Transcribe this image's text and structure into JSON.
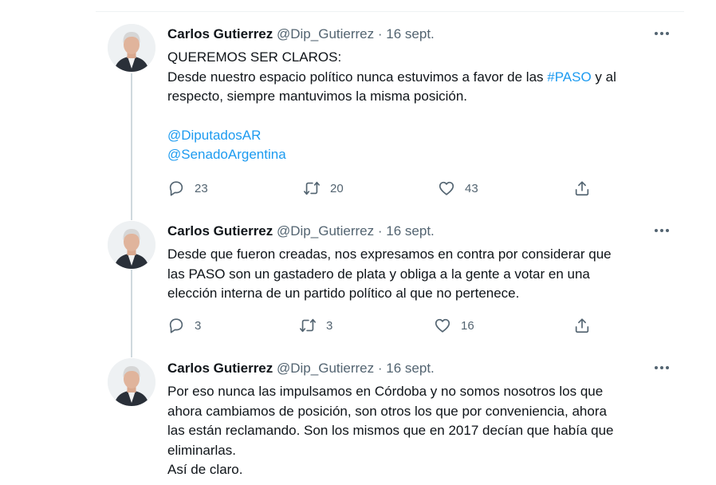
{
  "tweets": [
    {
      "name": "Carlos Gutierrez",
      "handle": "@Dip_Gutierrez",
      "separator": "·",
      "date": "16 sept.",
      "line1": "QUEREMOS SER CLAROS:",
      "line2_pre": "Desde nuestro espacio político nunca estuvimos a favor de las ",
      "hashtag": "#PASO",
      "line2_post": " y al",
      "line3": "respecto, siempre mantuvimos la misma posición.",
      "mention1": "@DiputadosAR",
      "mention2": "@SenadoArgentina",
      "replies": "23",
      "retweets": "20",
      "likes": "43"
    },
    {
      "name": "Carlos Gutierrez",
      "handle": "@Dip_Gutierrez",
      "separator": "·",
      "date": "16 sept.",
      "line1": "Desde que fueron creadas, nos expresamos en contra por considerar que",
      "line2": "las PASO son un gastadero de plata y obliga a la gente a votar en una",
      "line3": "elección interna de un partido político al que no pertenece.",
      "replies": "3",
      "retweets": "3",
      "likes": "16"
    },
    {
      "name": "Carlos Gutierrez",
      "handle": "@Dip_Gutierrez",
      "separator": "·",
      "date": "16 sept.",
      "line1": "Por eso nunca las impulsamos en Córdoba y no somos nosotros los que",
      "line2": "ahora cambiamos de posición, son otros los que por conveniencia, ahora",
      "line3": "las están reclamando. Son los mismos que en 2017 decían que había que",
      "line4": "eliminarlas.",
      "line5": "Así de claro."
    }
  ],
  "icons": {
    "more": "more-horizontal-icon",
    "reply": "reply-icon",
    "retweet": "retweet-icon",
    "like": "heart-icon",
    "share": "share-icon"
  },
  "colors": {
    "link": "#1d9bf0",
    "secondary_text": "#536471",
    "thread_line": "#cfd9de"
  }
}
